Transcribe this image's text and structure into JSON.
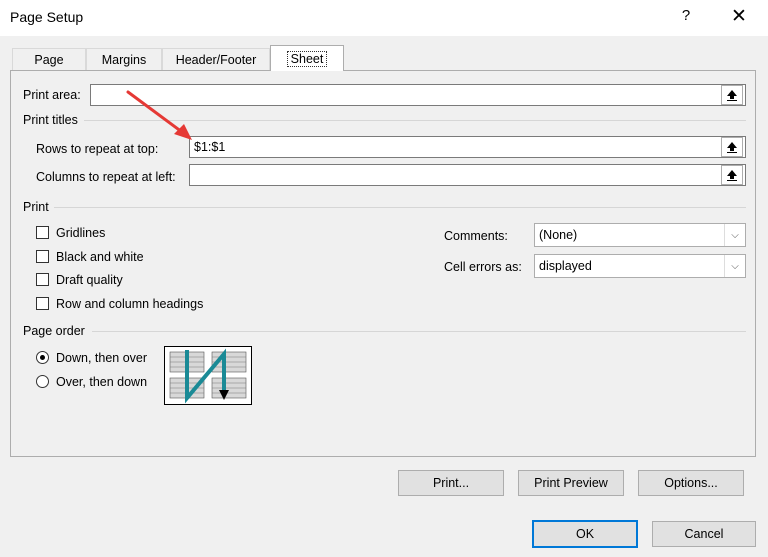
{
  "window": {
    "title": "Page Setup",
    "help": "?",
    "close": "✕"
  },
  "tabs": [
    {
      "label": "Page"
    },
    {
      "label": "Margins"
    },
    {
      "label": "Header/Footer"
    },
    {
      "label": "Sheet",
      "active": true
    }
  ],
  "print_area": {
    "label": "Print area:",
    "value": ""
  },
  "print_titles": {
    "heading": "Print titles",
    "rows_label": "Rows to repeat at top:",
    "rows_value": "$1:$1",
    "cols_label": "Columns to repeat at left:",
    "cols_value": ""
  },
  "print": {
    "heading": "Print",
    "gridlines": "Gridlines",
    "black_white": "Black and white",
    "draft_quality": "Draft quality",
    "row_col_headings": "Row and column headings",
    "comments_label": "Comments:",
    "comments_value": "(None)",
    "cell_errors_label": "Cell errors as:",
    "cell_errors_value": "displayed"
  },
  "page_order": {
    "heading": "Page order",
    "down_then_over": "Down, then over",
    "over_then_down": "Over, then down",
    "selected": "down_then_over"
  },
  "buttons": {
    "print": "Print...",
    "print_preview": "Print Preview",
    "options": "Options...",
    "ok": "OK",
    "cancel": "Cancel"
  },
  "colors": {
    "accent": "#0078d7",
    "annotation_arrow": "#e53935",
    "page_order_arrow": "#1a8a96"
  },
  "icons": {
    "collapse": "collapse-dialog-icon",
    "dropdown": "chevron-down-icon"
  }
}
